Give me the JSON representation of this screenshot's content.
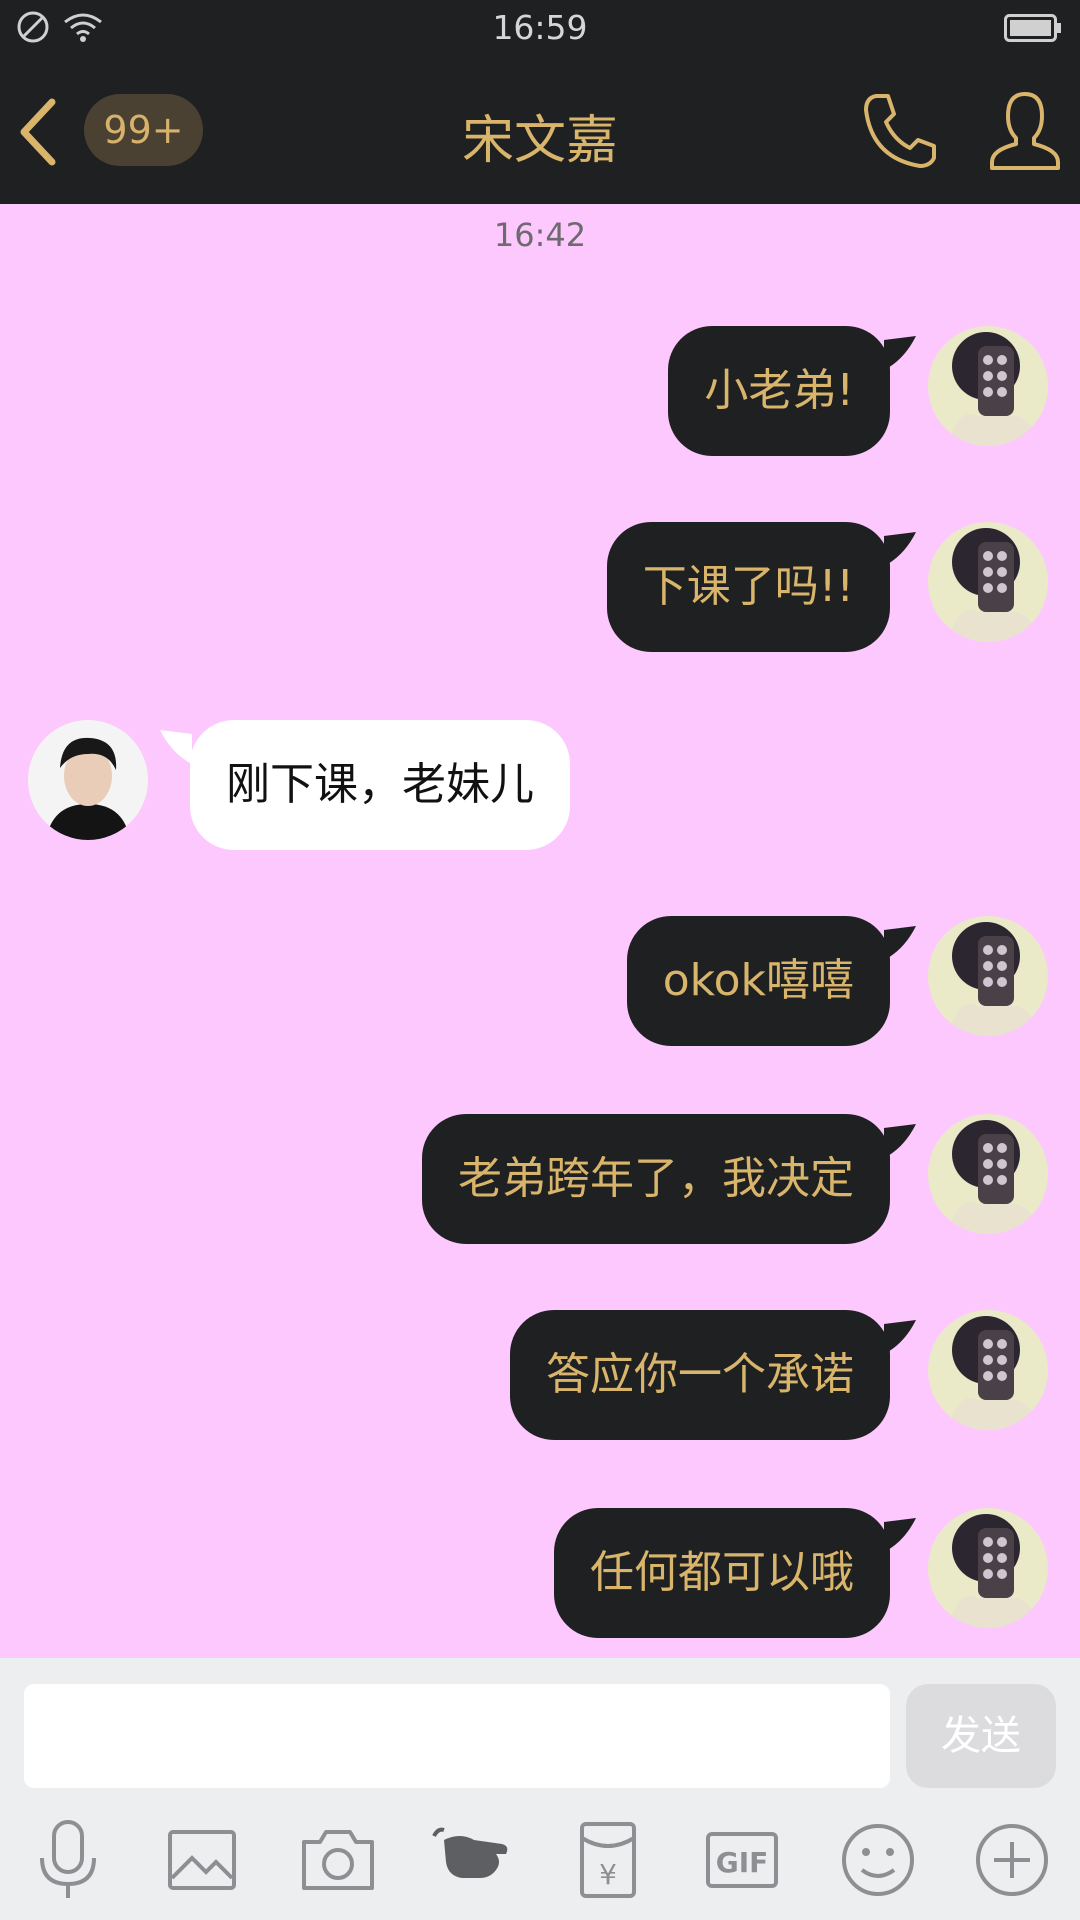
{
  "status_bar": {
    "time": "16:59"
  },
  "header": {
    "badge": "99+",
    "title": "宋文嘉"
  },
  "chat": {
    "timestamp": "16:42",
    "messages": [
      {
        "side": "out",
        "text": "小老弟!"
      },
      {
        "side": "out",
        "text": "下课了吗!!"
      },
      {
        "side": "in",
        "text": "刚下课，老妹儿"
      },
      {
        "side": "out",
        "text": "okok嘻嘻"
      },
      {
        "side": "out",
        "text": "老弟跨年了，我决定"
      },
      {
        "side": "out",
        "text": "答应你一个承诺"
      },
      {
        "side": "out",
        "text": "任何都可以哦"
      }
    ]
  },
  "input": {
    "text": "",
    "send_label": "发送"
  },
  "toolbar": {
    "icons": [
      "microphone-icon",
      "image-icon",
      "camera-icon",
      "poke-hand-icon",
      "red-packet-icon",
      "gif-icon",
      "emoji-icon",
      "plus-icon"
    ]
  },
  "colors": {
    "bar_bg": "#1f2022",
    "accent_gold": "#d9b46b",
    "chat_bg": "#fdc8fd",
    "incoming_bubble": "#ffffff"
  }
}
